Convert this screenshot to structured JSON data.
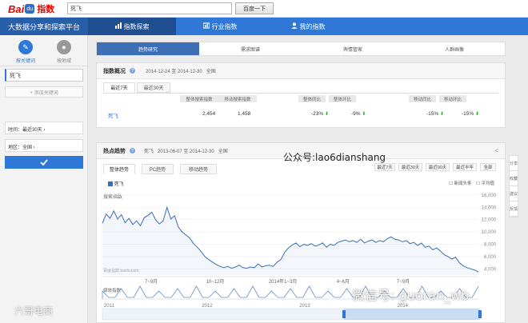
{
  "header": {
    "logo_text_1": "Bai",
    "logo_paw": "du",
    "logo_text_2": "指数",
    "search_value": "死飞",
    "search_button": "百度一下"
  },
  "nav": {
    "platform_title": "大数据分享和探索平台",
    "tabs": [
      {
        "label": "指数探索",
        "icon": "chart-icon"
      },
      {
        "label": "行业指数",
        "icon": "bar-icon"
      },
      {
        "label": "我的指数",
        "icon": "user-icon"
      }
    ]
  },
  "sidebar": {
    "tab_keywords": "按关键词",
    "tab_region": "按地域",
    "keyword": "死飞",
    "add_keyword": "+ 添加关键词",
    "time_filter": "时间：最近30天 ›",
    "region_filter": "地区：全国 ›",
    "confirm_icon": "check-icon"
  },
  "subtabs": [
    "趋势研究",
    "需求图谱",
    "舆情管家",
    "人群画像"
  ],
  "overview": {
    "title": "指数概况",
    "date_range": "2014-12-24 至 2014-12-30",
    "region": "全国",
    "pill_7": "最近7天",
    "pill_30": "最近30天",
    "columns": [
      "整体搜索指数",
      "移动搜索指数",
      "整体同比",
      "整体环比",
      "移动同比",
      "移动环比"
    ],
    "row": {
      "keyword": "死飞",
      "overall": "2,454",
      "mobile": "1,458",
      "overall_yoy": "-23%",
      "overall_mom": "-9%",
      "mobile_yoy": "-15%",
      "mobile_mom": "-15%"
    }
  },
  "trend": {
    "title": "热点趋势",
    "keyword": "死飞",
    "date_range": "2013-06-07 至 2014-12-30",
    "region": "全国",
    "tabs": [
      "整体趋势",
      "PC趋势",
      "移动趋势"
    ],
    "ranges": [
      "最近7天",
      "最近30天",
      "最近90天",
      "最近半年",
      "全部"
    ],
    "legend_keyword": "死飞",
    "opt_news": "新闻头条",
    "opt_avg": "平均值",
    "search_index_label": "搜索指数",
    "media_index_label": "媒体指数",
    "credit": "百度指数 baidu.com",
    "y_ticks": [
      "16,000",
      "14,000",
      "12,000",
      "10,000",
      "8,000",
      "6,000",
      "4,000"
    ],
    "x_ticks": [
      "7~9月",
      "10~12月",
      "2014年1~3月",
      "4~6月",
      "7~9月"
    ],
    "timeline_ticks": [
      "2011",
      "2012",
      "2013",
      "2014"
    ]
  },
  "side_tools": [
    "分享",
    "收藏",
    "建议",
    "反馈"
  ],
  "watermarks": {
    "center": "公众号:lao6dianshang",
    "bottom_right": "微信号: guoran_wb",
    "bottom_left": "六哥电商"
  },
  "chart_data": {
    "type": "line",
    "ylim": [
      3000,
      16500
    ],
    "series": [
      {
        "name": "死飞",
        "values": [
          11400,
          12900,
          12200,
          13400,
          12100,
          12800,
          11500,
          12200,
          11200,
          11800,
          11000,
          12300,
          12700,
          13200,
          12000,
          11300,
          11800,
          14000,
          12100,
          12600,
          10800,
          10000,
          9500,
          9000,
          8100,
          7500,
          6800,
          6000,
          5500,
          5100,
          4700,
          4400,
          4200,
          4400,
          4100,
          4300,
          4600,
          4200,
          4100,
          4300,
          4200,
          4800,
          4300,
          4500,
          4600,
          4400,
          5100,
          5500,
          6700,
          7400,
          7900,
          8200,
          7600,
          8000,
          7800,
          8100,
          7700,
          7900,
          8200,
          7500,
          8000,
          7800,
          8300,
          8500,
          8700,
          8400,
          8600,
          8300,
          8800,
          8200,
          8500,
          8700,
          8300,
          8600,
          8400,
          8900,
          9200,
          8800,
          8700,
          8400,
          8600,
          8100,
          8300,
          7800,
          8200,
          7500,
          7700,
          7100,
          7400,
          6900,
          6300,
          6000,
          5600,
          5900,
          5000,
          4500,
          4200,
          4000,
          3800,
          3500
        ]
      }
    ]
  }
}
